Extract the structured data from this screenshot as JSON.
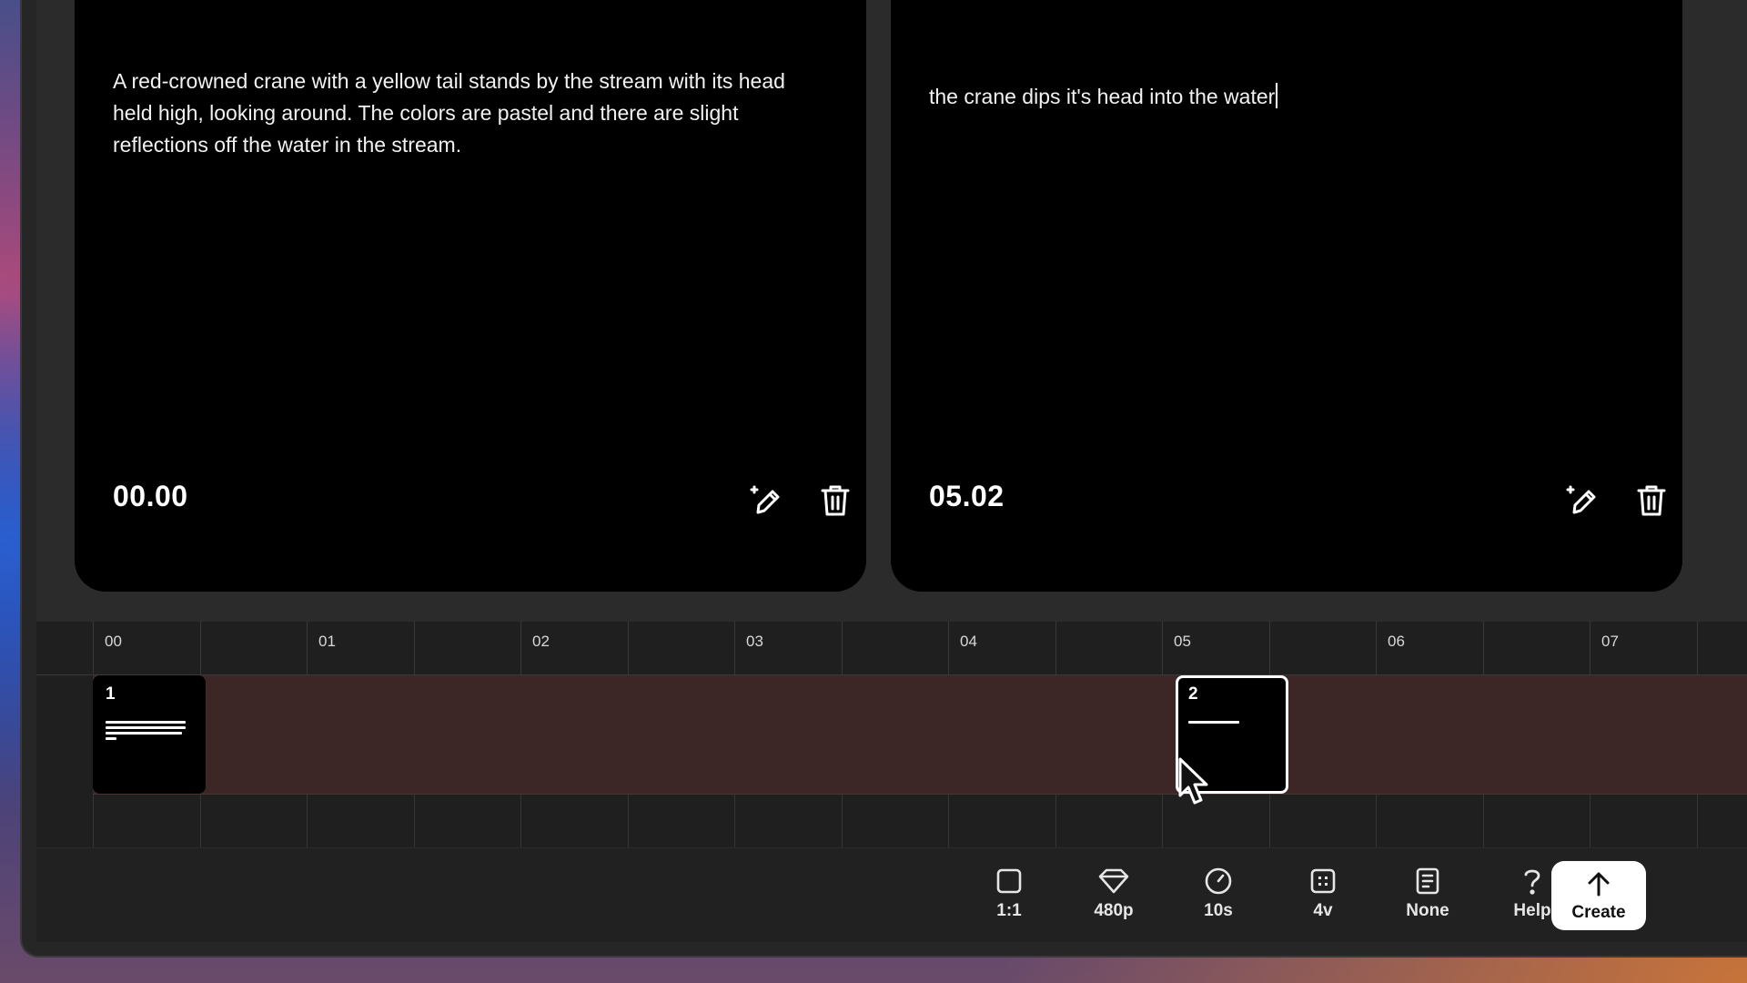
{
  "cards": [
    {
      "prompt": "A red-crowned crane with a yellow tail stands by the stream with its head held high, looking around. The colors are pastel and there are slight reflections off the water in the stream.",
      "time": "00.00",
      "edit_icon": "magic-pencil-icon",
      "delete_icon": "trash-icon"
    },
    {
      "prompt": "the crane dips it's head into the water",
      "time": "05.02",
      "edit_icon": "magic-pencil-icon",
      "delete_icon": "trash-icon"
    }
  ],
  "timeline": {
    "ticks": [
      "00",
      "01",
      "02",
      "03",
      "04",
      "05",
      "06",
      "07"
    ],
    "clips": [
      {
        "number": "1"
      },
      {
        "number": "2"
      }
    ]
  },
  "toolbar": {
    "items": [
      {
        "label": "1:1",
        "icon": "aspect-square-icon"
      },
      {
        "label": "480p",
        "icon": "diamond-icon"
      },
      {
        "label": "10s",
        "icon": "clock-icon"
      },
      {
        "label": "4v",
        "icon": "grid-icon"
      },
      {
        "label": "None",
        "icon": "document-icon"
      },
      {
        "label": "Help",
        "icon": "question-icon"
      }
    ],
    "create": {
      "label": "Create",
      "icon": "arrow-up-icon"
    }
  },
  "colors": {
    "card_bg": "#000000",
    "timeline_track": "#3d2626",
    "create_bg": "#ffffff"
  }
}
